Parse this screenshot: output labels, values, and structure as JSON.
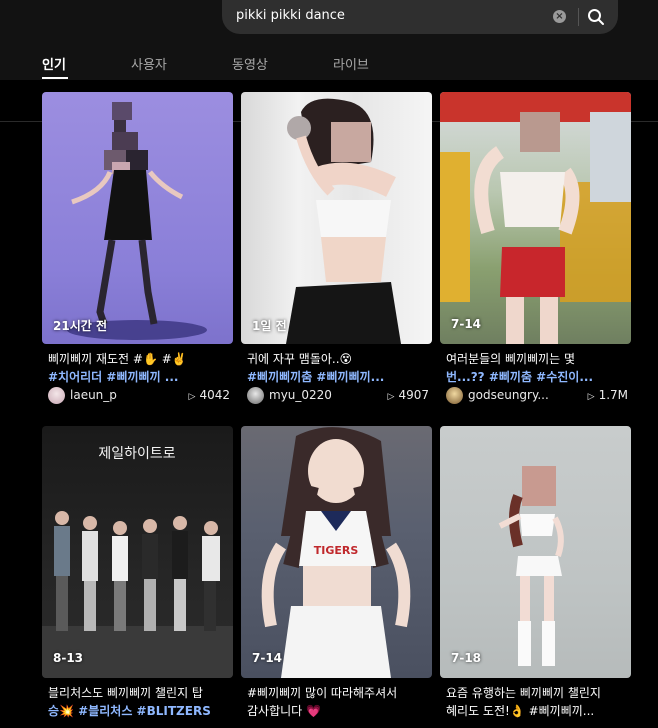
{
  "search": {
    "query": "pikki pikki dance",
    "clear_icon": "x-circle-icon",
    "search_icon": "magnifier-icon"
  },
  "tabs": [
    {
      "label": "인기",
      "active": true
    },
    {
      "label": "사용자",
      "active": false
    },
    {
      "label": "동영상",
      "active": false
    },
    {
      "label": "라이브",
      "active": false
    }
  ],
  "videos": [
    {
      "time": "21시간 전",
      "line1": "삐끼삐끼 재도전 #✋ #✌️",
      "line2": "#치어리더 #삐끼삐끼 ...",
      "user": "laeun_p",
      "plays": "4042"
    },
    {
      "time": "1일 전",
      "line1": "귀에 자꾸 맴돌아..😵",
      "line2": "#삐끼삐끼춤 #삐끼삐끼...",
      "user": "myu_0220",
      "plays": "4907"
    },
    {
      "time": "7-14",
      "line1": "여러분들의 삐끼삐끼는 몇",
      "line2": "번...?? #삐끼춤 #수진이...",
      "user": "godseungry...",
      "plays": "1.7M"
    },
    {
      "time": "8-13",
      "line1": "블리처스도 삐끼삐끼 챌린지 탑",
      "line2": "승💥 #블리처스 #BLITZERS",
      "user": "",
      "plays": ""
    },
    {
      "time": "7-14",
      "line1": "#삐끼삐끼 많이 따라해주셔서",
      "line2": "감사합니다 💗",
      "user": "",
      "plays": ""
    },
    {
      "time": "7-18",
      "line1": "요즘 유행하는 삐끼삐끼 챌린지",
      "line2": "혜리도 도전!👌 #삐끼삐끼...",
      "user": "",
      "plays": ""
    }
  ],
  "thumbnail_texts": {
    "neon_sign": "제일하이트로",
    "jersey": "TIGERS"
  },
  "colors": {
    "hashtag": "#8fb8ff",
    "background": "#000000",
    "bar": "#121212",
    "search_bg": "#2f2f2f"
  }
}
